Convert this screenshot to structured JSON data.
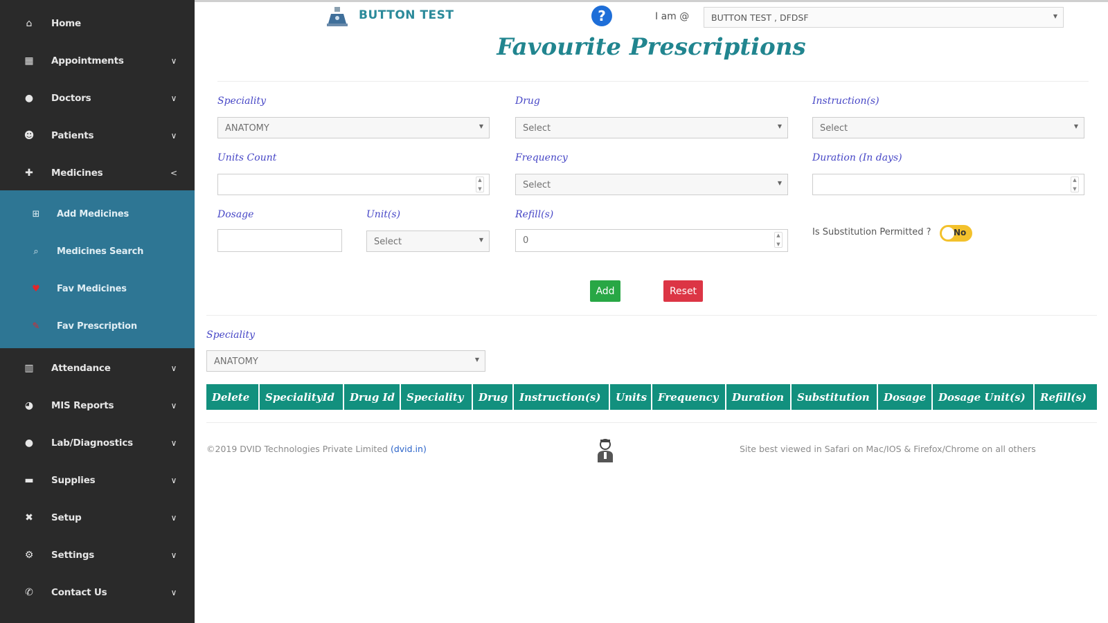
{
  "sidebar": {
    "items": [
      {
        "label": "Home",
        "icon": "home-icon"
      },
      {
        "label": "Appointments",
        "icon": "calendar-icon"
      },
      {
        "label": "Doctors",
        "icon": "doctor-icon"
      },
      {
        "label": "Patients",
        "icon": "patients-icon"
      },
      {
        "label": "Medicines",
        "icon": "medicines-icon"
      },
      {
        "label": "Attendance",
        "icon": "book-icon"
      },
      {
        "label": "MIS Reports",
        "icon": "reports-icon"
      },
      {
        "label": "Lab/Diagnostics",
        "icon": "lab-icon"
      },
      {
        "label": "Supplies",
        "icon": "supplies-icon"
      },
      {
        "label": "Setup",
        "icon": "tools-icon"
      },
      {
        "label": "Settings",
        "icon": "gear-icon"
      },
      {
        "label": "Contact Us",
        "icon": "phone-icon"
      }
    ],
    "submenu": [
      {
        "label": "Add Medicines",
        "icon": "plus-square-icon"
      },
      {
        "label": "Medicines Search",
        "icon": "search-icon"
      },
      {
        "label": "Fav Medicines",
        "icon": "heart-icon"
      },
      {
        "label": "Fav Prescription",
        "icon": "pencil-icon"
      }
    ]
  },
  "header": {
    "brand": "BUTTON TEST",
    "help": "?",
    "iam_label": "I am @",
    "iam_value": "BUTTON TEST , DFDSF"
  },
  "page_title": "Favourite Prescriptions",
  "form": {
    "speciality_label": "Speciality",
    "speciality_value": "ANATOMY",
    "drug_label": "Drug",
    "drug_value": "Select",
    "instruction_label": "Instruction(s)",
    "instruction_value": "Select",
    "units_count_label": "Units Count",
    "units_count_value": "",
    "frequency_label": "Frequency",
    "frequency_value": "Select",
    "duration_label": "Duration (In days)",
    "duration_value": "",
    "dosage_label": "Dosage",
    "dosage_value": "",
    "units_label": "Unit(s)",
    "units_value": "Select",
    "refills_label": "Refill(s)",
    "refills_value": "0",
    "substitution_label": "Is Substitution Permitted ?",
    "substitution_value": "No",
    "add_label": "Add",
    "reset_label": "Reset"
  },
  "filter": {
    "speciality_label": "Speciality",
    "speciality_value": "ANATOMY"
  },
  "table": {
    "headers": [
      "Delete",
      "SpecialityId",
      "Drug Id",
      "Speciality",
      "Drug",
      "Instruction(s)",
      "Units",
      "Frequency",
      "Duration",
      "Substitution",
      "Dosage",
      "Dosage Unit(s)",
      "Refill(s)"
    ]
  },
  "footer": {
    "copyright": "©2019 DVID Technologies Private Limited",
    "link": "(dvid.in)",
    "browser_note": "Site best viewed in Safari on Mac/IOS & Firefox/Chrome on all others"
  },
  "colors": {
    "sidebar_bg": "#2a2a2a",
    "submenu_bg": "#2e7694",
    "accent": "#21858f",
    "table_header": "#12907e",
    "add_button": "#28a745",
    "reset_button": "#dc3545",
    "toggle": "#f3c12c"
  }
}
